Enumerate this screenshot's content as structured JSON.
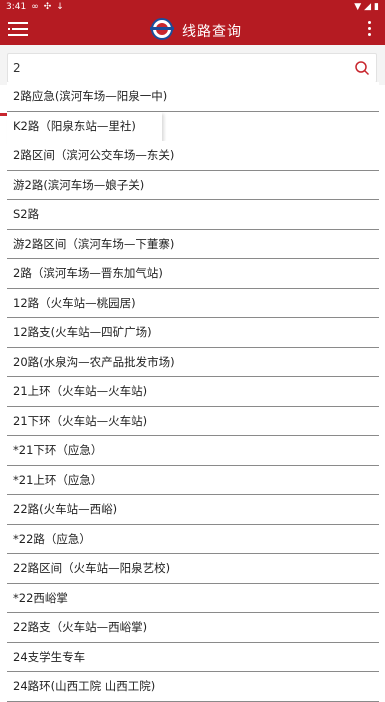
{
  "status_bar": {
    "time": "3:41"
  },
  "header": {
    "title": "线路查询"
  },
  "search": {
    "value": "2",
    "placeholder": ""
  },
  "results": [
    "2路应急(滨河车场—阳泉一中)",
    "K2路（阳泉东站—里社)",
    "2路区间（滨河公交车场—东关)",
    "游2路(滨河车场—娘子关)",
    "S2路",
    "游2路区间（滨河车场—下董寨)",
    "2路（滨河车场—晋东加气站)",
    "12路（火车站—桃园居)",
    "12路支(火车站—四矿广场)",
    "20路(水泉沟—农产品批发市场)",
    "21上环（火车站—火车站)",
    "21下环（火车站—火车站)",
    "*21下环（应急）",
    "*21上环（应急）",
    "22路(火车站—西峪)",
    "*22路（应急）",
    "22路区间（火车站—阳泉艺校)",
    "*22西峪掌",
    "22路支（火车站—西峪掌)",
    "24支学生专车",
    "24路环(山西工院 山西工院)"
  ],
  "colors": {
    "brand_red": "#b51b22",
    "logo_blue": "#1b4d9b"
  }
}
